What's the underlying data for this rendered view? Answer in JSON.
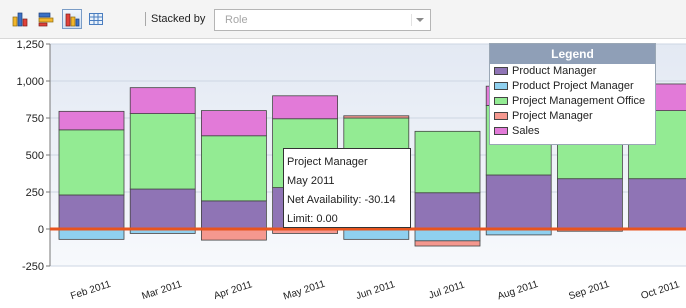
{
  "toolbar": {
    "buttons": [
      {
        "name": "bar-chart-icon",
        "active": false
      },
      {
        "name": "stacked-chart-icon",
        "active": false
      },
      {
        "name": "grouped-chart-icon",
        "active": true
      },
      {
        "name": "table-icon",
        "active": false
      }
    ],
    "stacked_by_label": "Stacked by",
    "stacked_by_value": "Role"
  },
  "colors": {
    "plot_background_top": "#e3e9f3",
    "plot_background_bottom": "#f7f9fc",
    "grid": "#cdd6e3",
    "zero_line": "#e8541e",
    "legend_header": "#8f9fb7"
  },
  "legend": {
    "title": "Legend",
    "items": [
      {
        "label": "Product Manager",
        "color": "#8f74b5"
      },
      {
        "label": "Product Project Manager",
        "color": "#8fd0ef"
      },
      {
        "label": "Project Management Office",
        "color": "#93eb93"
      },
      {
        "label": "Project Manager",
        "color": "#f5988f"
      },
      {
        "label": "Sales",
        "color": "#e27ad8"
      }
    ]
  },
  "tooltip": {
    "series": "Project Manager",
    "month": "May 2011",
    "net_availability": "Net Availability: -30.14",
    "limit": "Limit: 0.00"
  },
  "chart_data": {
    "type": "bar",
    "stacked": true,
    "categories": [
      "Feb 2011",
      "Mar 2011",
      "Apr 2011",
      "May 2011",
      "Jun 2011",
      "Jul 2011",
      "Aug 2011",
      "Sep 2011",
      "Oct 2011"
    ],
    "series": [
      {
        "name": "Product Manager",
        "color": "#8f74b5",
        "values": [
          230,
          270,
          190,
          280,
          220,
          245,
          365,
          340,
          340
        ]
      },
      {
        "name": "Product Project Manager",
        "color": "#8fd0ef",
        "values": [
          -70,
          -30,
          0,
          0,
          -70,
          -80,
          -40,
          0,
          0
        ]
      },
      {
        "name": "Project Management Office",
        "color": "#93eb93",
        "values": [
          440,
          510,
          440,
          465,
          530,
          415,
          470,
          440,
          460
        ]
      },
      {
        "name": "Project Manager",
        "color": "#f5988f",
        "values": [
          0,
          0,
          -75,
          -30.14,
          15,
          -35,
          0,
          -15,
          0
        ]
      },
      {
        "name": "Sales",
        "color": "#e27ad8",
        "values": [
          125,
          175,
          170,
          155,
          0,
          0,
          130,
          190,
          180
        ]
      }
    ],
    "ylim": [
      -250,
      1250
    ],
    "yticks": [
      -250,
      0,
      250,
      500,
      750,
      1000,
      1250
    ],
    "ytick_labels": [
      "-250",
      "0",
      "250",
      "500",
      "750",
      "1,000",
      "1,250"
    ],
    "grid": true,
    "limit": 0,
    "legend_position": "top-right"
  }
}
